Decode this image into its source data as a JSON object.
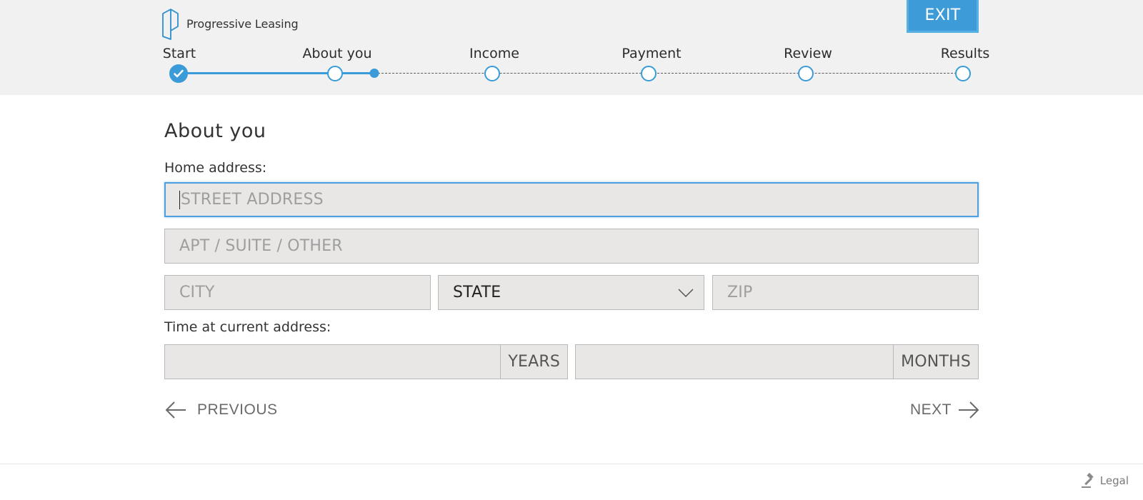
{
  "brand": {
    "name": "Progressive Leasing",
    "accent": "#3a9bd8"
  },
  "header": {
    "exit_label": "EXIT"
  },
  "progress": {
    "steps": [
      {
        "label": "Start",
        "status": "complete"
      },
      {
        "label": "About you",
        "status": "current"
      },
      {
        "label": "Income",
        "status": "upcoming"
      },
      {
        "label": "Payment",
        "status": "upcoming"
      },
      {
        "label": "Review",
        "status": "upcoming"
      },
      {
        "label": "Results",
        "status": "upcoming"
      }
    ]
  },
  "form": {
    "title": "About you",
    "home_address_label": "Home address:",
    "street": {
      "placeholder": "STREET ADDRESS",
      "value": ""
    },
    "apt": {
      "placeholder": "APT / SUITE / OTHER",
      "value": ""
    },
    "city": {
      "placeholder": "CITY",
      "value": ""
    },
    "state": {
      "selected": "STATE"
    },
    "zip": {
      "placeholder": "ZIP",
      "value": ""
    },
    "time_label": "Time at current address:",
    "years_suffix": "YEARS",
    "months_suffix": "MONTHS"
  },
  "nav": {
    "previous_label": "PREVIOUS",
    "next_label": "NEXT"
  },
  "footer": {
    "legal_label": "Legal",
    "legal_icon": "gavel-icon"
  }
}
